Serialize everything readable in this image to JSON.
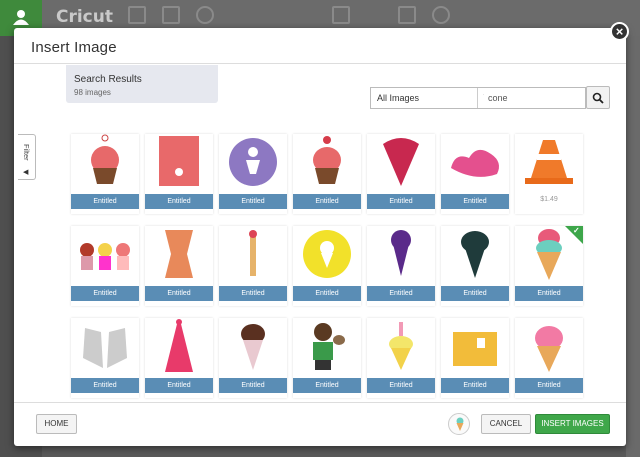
{
  "app": {
    "logo": "Cricut"
  },
  "modal": {
    "title": "Insert Image",
    "close_glyph": "×"
  },
  "search_results": {
    "title": "Search Results",
    "count_text": "98 images"
  },
  "search": {
    "filter_value": "All Images",
    "query": "cone",
    "search_icon": "search-icon"
  },
  "filter_tab": {
    "label": "Filter",
    "arrow": "◀"
  },
  "images": [
    {
      "badge": "Entitled",
      "icon": "ice-cream-cupcake-pink"
    },
    {
      "badge": "Entitled",
      "icon": "ice-cream-tag-coral"
    },
    {
      "badge": "Entitled",
      "icon": "ice-cream-circle-purple"
    },
    {
      "badge": "Entitled",
      "icon": "ice-cream-cupcake-red"
    },
    {
      "badge": "Entitled",
      "icon": "ice-cream-cone-crimson"
    },
    {
      "badge": "Entitled",
      "icon": "pink-splash"
    },
    {
      "badge": "",
      "price": "$1.49",
      "icon": "traffic-cone"
    },
    {
      "badge": "Entitled",
      "icon": "three-cupcakes"
    },
    {
      "badge": "Entitled",
      "icon": "bow-ribbon-orange"
    },
    {
      "badge": "Entitled",
      "icon": "ice-cream-pole"
    },
    {
      "badge": "Entitled",
      "icon": "ice-cream-circle-yellow"
    },
    {
      "badge": "Entitled",
      "icon": "ice-cream-cone-purple"
    },
    {
      "badge": "Entitled",
      "icon": "ice-cream-chalkboard"
    },
    {
      "badge": "Entitled",
      "icon": "ice-cream-cone-mint",
      "checked": true
    },
    {
      "badge": "Entitled",
      "icon": "hands-gray"
    },
    {
      "badge": "Entitled",
      "icon": "tassel-pink"
    },
    {
      "badge": "Entitled",
      "icon": "ice-cream-cone-brown"
    },
    {
      "badge": "Entitled",
      "icon": "boy-with-ice-cream"
    },
    {
      "badge": "Entitled",
      "icon": "ice-cream-candle"
    },
    {
      "badge": "Entitled",
      "icon": "box-yellow"
    },
    {
      "badge": "Entitled",
      "icon": "ice-cream-cone-pink"
    }
  ],
  "footer": {
    "home_label": "HOME",
    "cancel_label": "CANCEL",
    "insert_label": "INSERT IMAGES"
  },
  "colors": {
    "entitled": "#5a8db5",
    "accent_green": "#3fa74a"
  }
}
